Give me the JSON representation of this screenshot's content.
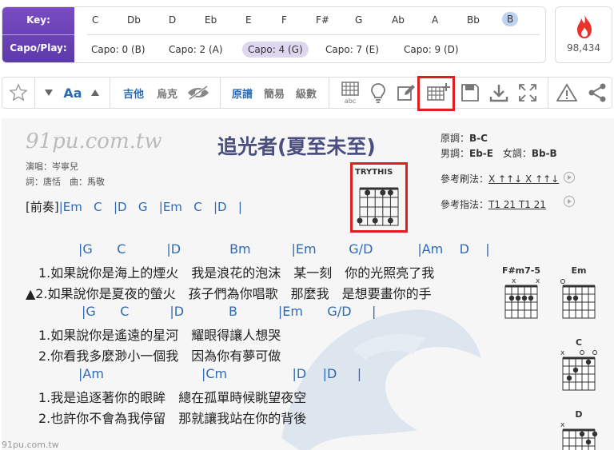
{
  "key_panel": {
    "key_label": "Key:",
    "capo_label": "Capo/Play:",
    "keys": [
      "C",
      "Db",
      "D",
      "Eb",
      "E",
      "F",
      "F#",
      "G",
      "Ab",
      "A",
      "Bb",
      "B"
    ],
    "selected_key": "B",
    "capo_options": [
      "Capo: 0 (B)",
      "Capo: 2 (A)",
      "Capo: 4 (G)",
      "Capo: 7 (E)",
      "Capo: 9 (D)"
    ],
    "selected_capo": "Capo: 4 (G)"
  },
  "views": {
    "count": "98,434",
    "icon": "flame-icon",
    "color": "#e8322b"
  },
  "toolbar": {
    "star": "star-icon",
    "font_label": "Aa",
    "guitar": "吉他",
    "ukulele": "烏克",
    "original": "原譜",
    "simple": "簡易",
    "level": "級數",
    "abc_label": "abc"
  },
  "sheet": {
    "watermark": "91pu.com.tw",
    "watermark_small": "91pu.com.tw",
    "title": "追光者(夏至未至)",
    "singer": "演唱：岑寧兒",
    "credits": "詞：唐恬　曲：馬敬",
    "original_key_label": "原調：",
    "original_key": "B-C",
    "male_key_label": "男調：",
    "male_key": "Eb-E",
    "female_key_label": "女調：",
    "female_key": "Bb-B",
    "strum_label": "參考刷法：",
    "strum_pattern": "X ↑↑↓ X ↑↑↓",
    "finger_label": "參考指法：",
    "finger_pattern": "T1 21 T1 21",
    "trythis": "TRYTHIS",
    "intro_label": "[前奏]",
    "intro_chords": "|Em   C   |D   G   |Em   C   |D   |",
    "lines": [
      {
        "chords": "|G      C          |D            Bm          |Em        G/D           |Am    D    |"
      },
      {
        "lyric": "1.如果說你是海上的煙火　我是浪花的泡沫　某一刻　你的光照亮了我"
      },
      {
        "lyric": "▲2.如果說你是夏夜的螢火　孩子們為你唱歌　那麼我　是想要畫你的手"
      },
      {
        "chords": "|G      C          |D           B          |Em      G/D     |"
      },
      {
        "lyric": "1.如果說你是遙遠的星河　耀眼得讓人想哭"
      },
      {
        "lyric": "2.你看我多麼渺小一個我　因為你有夢可做"
      },
      {
        "chords": "|Am                        |Cm                |D    |D     |"
      },
      {
        "lyric": "1.我是追逐著你的眼眸　總在孤單時候眺望夜空"
      },
      {
        "lyric": "2.也許你不會為我停留　那就讓我站在你的背後"
      }
    ],
    "chord_diagrams": [
      "F#m7-5",
      "Em",
      "C",
      "D"
    ]
  },
  "colors": {
    "accent_purple": "#6a42b8",
    "chord_blue": "#2d6ab8",
    "highlight_red": "#e02020"
  }
}
